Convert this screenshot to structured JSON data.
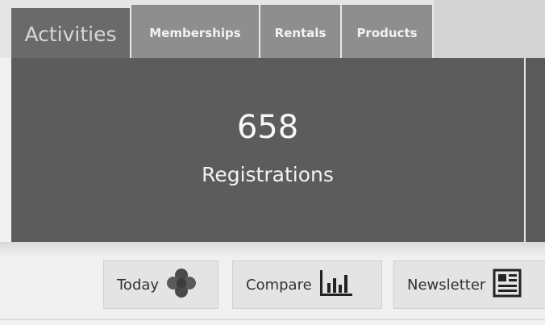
{
  "tabs": {
    "activities": "Activities",
    "memberships": "Memberships",
    "rentals": "Rentals",
    "products": "Products"
  },
  "summary": {
    "count": "658",
    "label": "Registrations"
  },
  "actions": {
    "today": {
      "label": "Today",
      "icon": "clover-icon"
    },
    "compare": {
      "label": "Compare",
      "icon": "bar-chart-icon"
    },
    "newsletter": {
      "label": "Newsletter",
      "icon": "newspaper-icon"
    }
  }
}
